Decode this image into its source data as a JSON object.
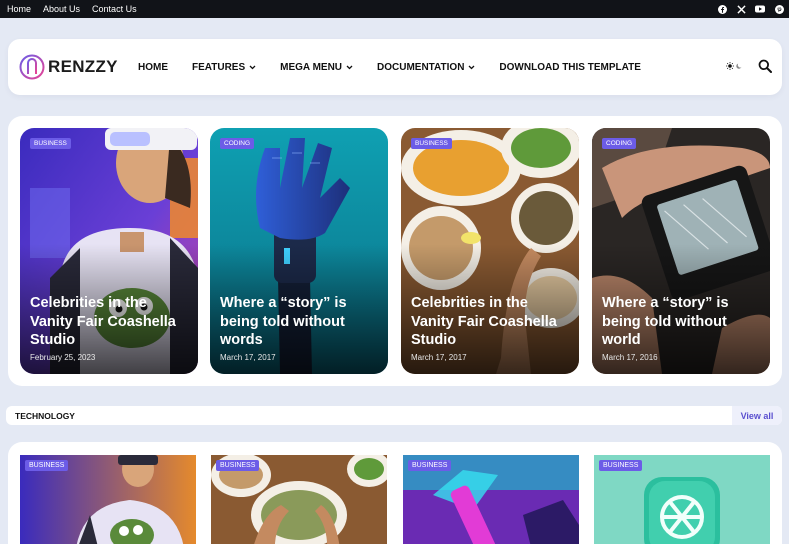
{
  "topbar": {
    "links": [
      "Home",
      "About Us",
      "Contact Us"
    ],
    "social": [
      "facebook-icon",
      "x-icon",
      "youtube-icon",
      "pinterest-icon"
    ]
  },
  "header": {
    "logo_text": "RENZZY",
    "nav": [
      {
        "label": "HOME",
        "dropdown": false
      },
      {
        "label": "FEATURES",
        "dropdown": true
      },
      {
        "label": "MEGA MENU",
        "dropdown": true
      },
      {
        "label": "DOCUMENTATION",
        "dropdown": true
      },
      {
        "label": "DOWNLOAD THIS TEMPLATE",
        "dropdown": false
      }
    ],
    "theme_icon": "sun-moon-toggle-icon",
    "search_icon": "search-icon"
  },
  "featured": [
    {
      "badge": "BUSINESS",
      "title": "Celebrities in the Vanity Fair Coashella Studio",
      "date": "February 25, 2023"
    },
    {
      "badge": "CODING",
      "title": "Where a “story” is being told without words",
      "date": "March 17, 2017"
    },
    {
      "badge": "BUSINESS",
      "title": "Celebrities in the Vanity Fair Coashella Studio",
      "date": "March 17, 2017"
    },
    {
      "badge": "CODING",
      "title": "Where a “story” is being told without world",
      "date": "March 17, 2016"
    }
  ],
  "section": {
    "title": "TECHNOLOGY",
    "view_all": "View all"
  },
  "grid": [
    {
      "badge": "BUSINESS"
    },
    {
      "badge": "BUSINESS"
    },
    {
      "badge": "BUSINESS"
    },
    {
      "badge": "BUSINESS"
    }
  ],
  "colors": {
    "accent": "#6c5ce7",
    "topbar": "#111318",
    "page_bg": "#e4e9f4"
  }
}
